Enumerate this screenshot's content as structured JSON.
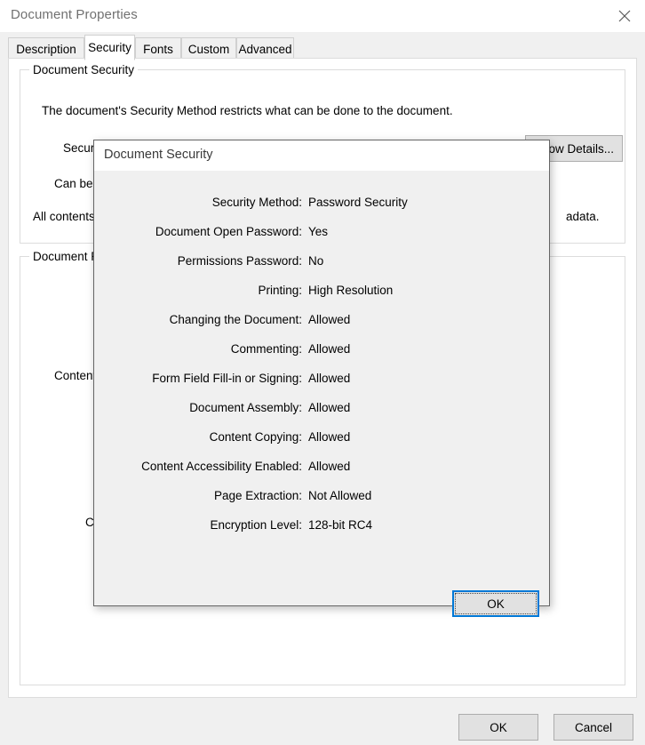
{
  "window": {
    "title": "Document Properties",
    "close_icon": "close-icon"
  },
  "tabs": [
    {
      "label": "Description",
      "selected": false
    },
    {
      "label": "Security",
      "selected": true
    },
    {
      "label": "Fonts",
      "selected": false
    },
    {
      "label": "Custom",
      "selected": false
    },
    {
      "label": "Advanced",
      "selected": false
    }
  ],
  "document_security_group": {
    "title": "Document Security",
    "description": "The document's Security Method restricts what can be done to the document.",
    "rows": [
      "Security Method:",
      "Can be O",
      "All contents"
    ],
    "trailing_text": "adata.",
    "show_details_label": "Show Details..."
  },
  "document_restrictions_group": {
    "title": "Document Re",
    "rows": [
      "Content C",
      "Cre"
    ]
  },
  "footer": {
    "ok_label": "OK",
    "cancel_label": "Cancel"
  },
  "dialog": {
    "title": "Document Security",
    "ok_label": "OK",
    "properties": [
      {
        "label": "Security Method:",
        "value": "Password Security"
      },
      {
        "label": "Document Open Password:",
        "value": "Yes"
      },
      {
        "label": "Permissions Password:",
        "value": "No"
      },
      {
        "label": "Printing:",
        "value": "High Resolution"
      },
      {
        "label": "Changing the Document:",
        "value": "Allowed"
      },
      {
        "label": "Commenting:",
        "value": "Allowed"
      },
      {
        "label": "Form Field Fill-in or Signing:",
        "value": "Allowed"
      },
      {
        "label": "Document Assembly:",
        "value": "Allowed"
      },
      {
        "label": "Content Copying:",
        "value": "Allowed"
      },
      {
        "label": "Content Accessibility Enabled:",
        "value": "Allowed"
      },
      {
        "label": "Page Extraction:",
        "value": "Not Allowed"
      },
      {
        "label": "Encryption Level:",
        "value": "128-bit RC4"
      }
    ]
  },
  "colors": {
    "accent": "#0078d7",
    "window_bg": "#f0f0f0",
    "panel_bg": "#ffffff",
    "button_face": "#e1e1e1",
    "title_text": "#717171"
  }
}
